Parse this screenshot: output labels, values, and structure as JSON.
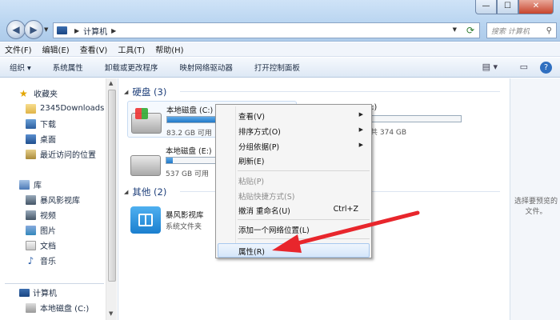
{
  "window": {
    "min": "—",
    "max": "☐",
    "close": "✕"
  },
  "address": {
    "path": [
      "计算机"
    ],
    "search_placeholder": "搜索 计算机"
  },
  "menubar": [
    "文件(F)",
    "编辑(E)",
    "查看(V)",
    "工具(T)",
    "帮助(H)"
  ],
  "commands": [
    "组织 ▾",
    "系统属性",
    "卸载或更改程序",
    "映射网络驱动器",
    "打开控制面板"
  ],
  "nav": {
    "favorites": "收藏夹",
    "fav_items": [
      "2345Downloads",
      "下载",
      "桌面",
      "最近访问的位置"
    ],
    "library": "库",
    "lib_items": [
      "暴风影视库",
      "视频",
      "图片",
      "文档",
      "音乐"
    ],
    "computer": "计算机",
    "drive_items": [
      "本地磁盘 (C:)"
    ]
  },
  "content": {
    "hdd_group": "硬盘 (3)",
    "other_group": "其他 (2)",
    "drives": [
      {
        "name": "本地磁盘 (C:)",
        "free": "83.2 GB 可用",
        "fill": 0.45
      },
      {
        "name": "D:)",
        "free": "共 374 GB",
        "fill": 0.3
      },
      {
        "name": "本地磁盘 (E:)",
        "free": "537 GB 可用",
        "fill": 0.05
      }
    ],
    "other": {
      "name": "暴风影视库",
      "type": "系统文件夹"
    }
  },
  "preview": {
    "text": "选择要预览的文件。"
  },
  "context_menu": {
    "view": "查看(V)",
    "sort": "排序方式(O)",
    "group": "分组依据(P)",
    "refresh": "刷新(E)",
    "paste": "粘贴(P)",
    "paste_shortcut": "粘贴快捷方式(S)",
    "undo": "撤消 重命名(U)",
    "undo_key": "Ctrl+Z",
    "add_net": "添加一个网络位置(L)",
    "properties": "属性(R)"
  },
  "colors": {
    "accent": "#1f78c8",
    "annotation_arrow": "#e8262c"
  }
}
